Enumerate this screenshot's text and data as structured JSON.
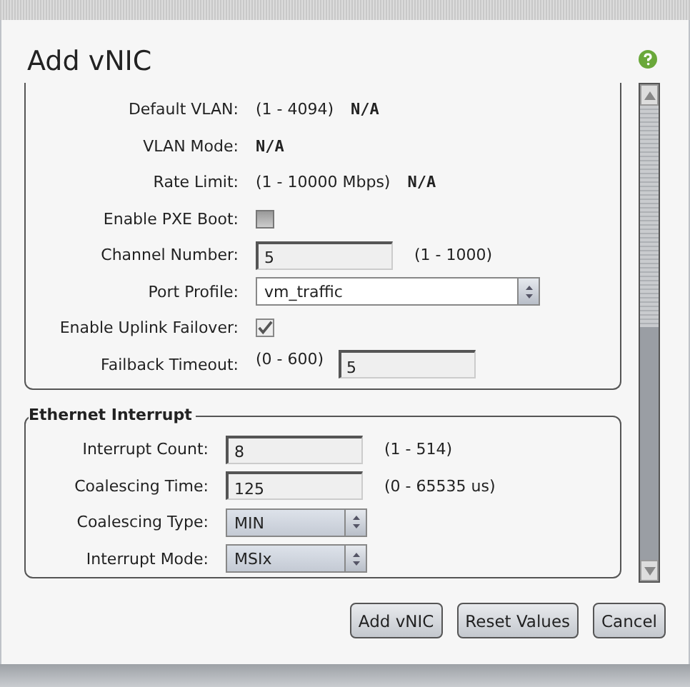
{
  "dialog": {
    "title": "Add vNIC"
  },
  "sections": [
    {
      "rows": [
        {
          "kind": "readonly",
          "label": "Default VLAN:",
          "range": "(1 - 4094)",
          "value": "N/A"
        },
        {
          "kind": "readonly",
          "label": "VLAN Mode:",
          "value": "N/A"
        },
        {
          "kind": "readonly",
          "label": "Rate Limit:",
          "range": "(1 - 10000 Mbps)",
          "value": "N/A"
        },
        {
          "kind": "checkbox",
          "label": "Enable PXE Boot:",
          "checked": false
        },
        {
          "kind": "input",
          "label": "Channel Number:",
          "value": "5",
          "range": "(1 - 1000)"
        },
        {
          "kind": "select",
          "label": "Port Profile:",
          "value": "vm_traffic"
        },
        {
          "kind": "checkbox",
          "label": "Enable Uplink Failover:",
          "checked": true
        },
        {
          "kind": "range-input",
          "label": "Failback Timeout:",
          "range": "(0 - 600)",
          "value": "5"
        }
      ]
    },
    {
      "legend": "Ethernet Interrupt",
      "rows": [
        {
          "kind": "input",
          "label": "Interrupt Count:",
          "value": "8",
          "range": "(1 - 514)"
        },
        {
          "kind": "input",
          "label": "Coalescing Time:",
          "value": "125",
          "range": "(0 - 65535 us)"
        },
        {
          "kind": "select",
          "label": "Coalescing Type:",
          "value": "MIN"
        },
        {
          "kind": "select",
          "label": "Interrupt Mode:",
          "value": "MSIx"
        }
      ]
    }
  ],
  "buttons": [
    "Add vNIC",
    "Reset Values",
    "Cancel"
  ]
}
